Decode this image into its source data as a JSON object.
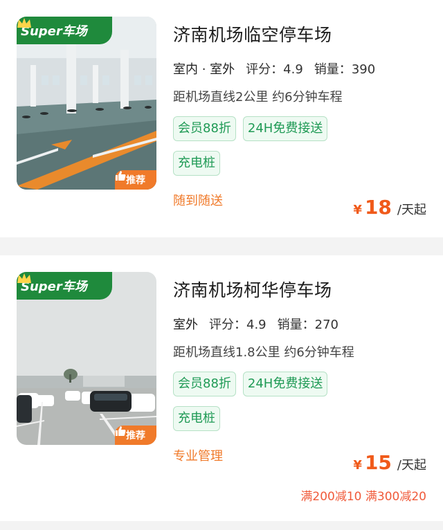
{
  "listings": [
    {
      "badge": "Super车场",
      "recommend": "推荐",
      "title": "济南机场临空停车场",
      "location": "室内 · 室外",
      "rating_label": "评分：",
      "rating": "4.9",
      "sales_label": "销量：",
      "sales": "390",
      "distance": "距机场直线2公里 约6分钟车程",
      "tags_row1": [
        "会员88折",
        "24H免费接送"
      ],
      "tags_row2": [
        "充电桩"
      ],
      "service": "随到随送",
      "price_currency": "¥",
      "price": "18",
      "price_unit": "/天起",
      "promo": ""
    },
    {
      "badge": "Super车场",
      "recommend": "推荐",
      "title": "济南机场柯华停车场",
      "location": "室外",
      "rating_label": "评分：",
      "rating": "4.9",
      "sales_label": "销量：",
      "sales": "270",
      "distance": "距机场直线1.8公里 约6分钟车程",
      "tags_row1": [
        "会员88折",
        "24H免费接送"
      ],
      "tags_row2": [
        "充电桩"
      ],
      "service": "专业管理",
      "price_currency": "¥",
      "price": "15",
      "price_unit": "/天起",
      "promo": "满200减10 满300减20"
    }
  ],
  "icons": {
    "crown": "crown-icon",
    "thumbs_up": "thumbs-up-icon"
  },
  "colors": {
    "badge_green": "#1f8a3c",
    "tag_green": "#1f9a55",
    "accent_orange": "#f07a2a",
    "price_red": "#f05a1a"
  }
}
